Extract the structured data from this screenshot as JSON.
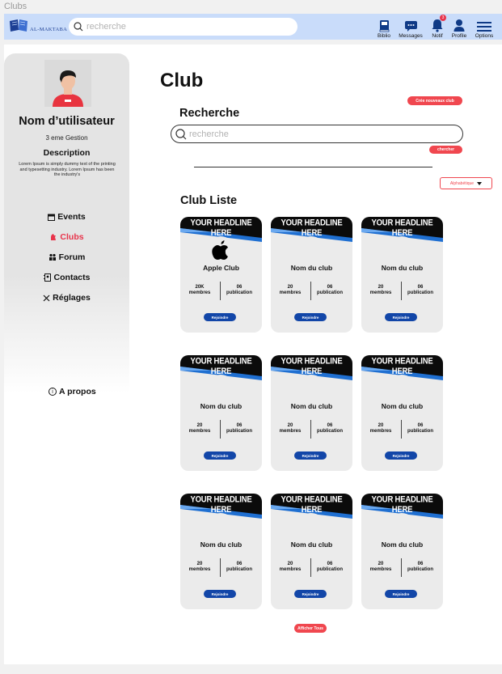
{
  "frame_label": "Clubs",
  "topbar": {
    "logo_text": "AL-MAKTABA",
    "search_placeholder": "recherche",
    "nav": [
      {
        "label": "Biblio",
        "icon": "book-icon"
      },
      {
        "label": "Messages",
        "icon": "message-icon"
      },
      {
        "label": "Notif",
        "icon": "bell-icon",
        "badge": "3"
      },
      {
        "label": "Profile",
        "icon": "user-icon"
      },
      {
        "label": "Options",
        "icon": "menu-icon"
      }
    ]
  },
  "sidebar": {
    "username": "Nom d’utilisateur",
    "level": "3 eme Gestion",
    "description_title": "Description",
    "description_text": "Lorem Ipsum is simply dummy text of the printing and typesetting industry. Lorem Ipsum has been the industry's",
    "menu": [
      {
        "label": "Events",
        "icon": "calendar-icon",
        "active": false
      },
      {
        "label": "Clubs",
        "icon": "clubs-icon",
        "active": true
      },
      {
        "label": "Forum",
        "icon": "forum-icon",
        "active": false
      },
      {
        "label": "Contacts",
        "icon": "contacts-icon",
        "active": false
      },
      {
        "label": "Réglages",
        "icon": "settings-icon",
        "active": false
      }
    ],
    "about_label": "A propos"
  },
  "main": {
    "title": "Club",
    "create_button": "Crée nouveaux club",
    "search_title": "Recherche",
    "search_placeholder": "recherche",
    "search_button": "chercher",
    "sort_label": "Alphabétique",
    "list_title": "Club Liste",
    "banner_text": "YOUR HEADLINE HERE",
    "join_label": "Rejoindre",
    "members_label": "membres",
    "publications_label": "publication",
    "show_all": "Afficher Tous",
    "clubs": [
      {
        "name": "Apple Club",
        "members": "20K",
        "publications": "06",
        "logo": "apple-icon"
      },
      {
        "name": "Nom du club",
        "members": "20",
        "publications": "06",
        "logo": ""
      },
      {
        "name": "Nom du club",
        "members": "20",
        "publications": "06",
        "logo": ""
      },
      {
        "name": "Nom du club",
        "members": "20",
        "publications": "06",
        "logo": ""
      },
      {
        "name": "Nom du club",
        "members": "20",
        "publications": "06",
        "logo": ""
      },
      {
        "name": "Nom du club",
        "members": "20",
        "publications": "06",
        "logo": ""
      },
      {
        "name": "Nom du club",
        "members": "20",
        "publications": "06",
        "logo": ""
      },
      {
        "name": "Nom du club",
        "members": "20",
        "publications": "06",
        "logo": ""
      },
      {
        "name": "Nom du club",
        "members": "20",
        "publications": "06",
        "logo": ""
      }
    ]
  },
  "colors": {
    "topbar": "#c9dcfa",
    "accent_red": "#f0474f",
    "join_blue": "#1246a8",
    "card_bg": "#ebebeb"
  }
}
